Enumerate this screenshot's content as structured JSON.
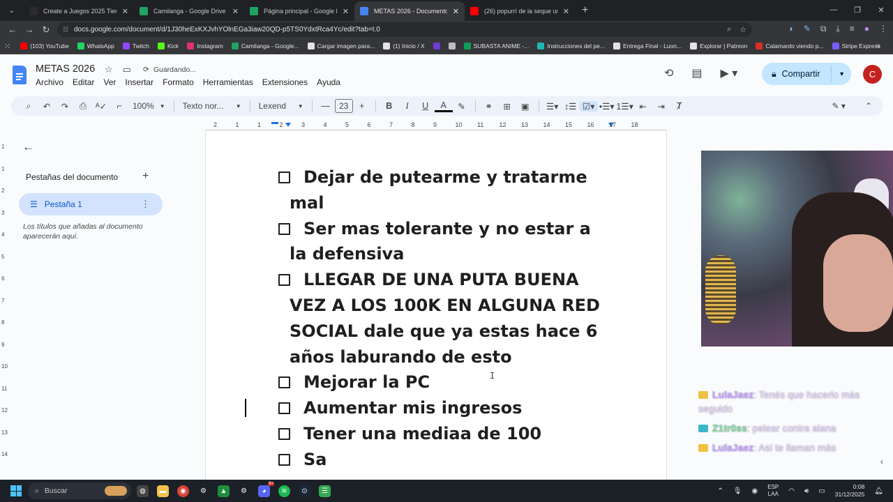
{
  "browser": {
    "tabs": [
      {
        "title": "Create a Juegos 2025 Tier List -",
        "color": "#2b2b2b",
        "active": false
      },
      {
        "title": "Camilanga - Google Drive",
        "color": "#1fa463",
        "active": false
      },
      {
        "title": "Página principal - Google Drive",
        "color": "#1fa463",
        "active": false
      },
      {
        "title": "METAS 2026 - Documentos de",
        "color": "#4285f4",
        "active": true
      },
      {
        "title": "(26) popurrí de ia seque un rio",
        "color": "#ff0000",
        "active": false
      }
    ],
    "url": "docs.google.com/document/d/1J30heExKXJvhYOlnEGa3iaw20QD-p5TS0YdxtRca4Yc/edit?tab=t.0",
    "bookmarks": [
      {
        "label": "(103) YouTube",
        "color": "#ff0000"
      },
      {
        "label": "WhatsApp",
        "color": "#25d366"
      },
      {
        "label": "Twitch",
        "color": "#9146ff"
      },
      {
        "label": "Kick",
        "color": "#53fc18"
      },
      {
        "label": "Instagram",
        "color": "#e1306c"
      },
      {
        "label": "Camilanga - Google...",
        "color": "#1fa463"
      },
      {
        "label": "Cargar imagen para...",
        "color": "#e3e3e3"
      },
      {
        "label": "(1) Inicio / X",
        "color": "#e3e3e3"
      },
      {
        "label": "",
        "color": "#6e3cd2"
      },
      {
        "label": "",
        "color": "#bdbdbd"
      },
      {
        "label": "SUBASTA ANIME -...",
        "color": "#0f9d58"
      },
      {
        "label": "Instrucciones del pe...",
        "color": "#1fb6b0"
      },
      {
        "label": "Entrega Final - Luon...",
        "color": "#e3e3e3"
      },
      {
        "label": "Explorar | Patreon",
        "color": "#e3e3e3"
      },
      {
        "label": "Calamardo viendo p...",
        "color": "#d93025"
      },
      {
        "label": "Stripe Express",
        "color": "#7a5cff"
      }
    ]
  },
  "docs": {
    "title": "METAS 2026",
    "saving": "Guardando...",
    "menu": [
      "Archivo",
      "Editar",
      "Ver",
      "Insertar",
      "Formato",
      "Herramientas",
      "Extensiones",
      "Ayuda"
    ],
    "share_label": "Compartir",
    "avatar_letter": "C",
    "toolbar": {
      "zoom": "100%",
      "style": "Texto nor...",
      "font": "Lexend",
      "font_size": "23"
    },
    "ruler": [
      "2",
      "1",
      "1",
      "2",
      "3",
      "4",
      "5",
      "6",
      "7",
      "8",
      "9",
      "10",
      "11",
      "12",
      "13",
      "14",
      "15",
      "16",
      "17",
      "18"
    ],
    "vruler": [
      "1",
      "1",
      "2",
      "3",
      "4",
      "5",
      "6",
      "7",
      "8",
      "9",
      "10",
      "11",
      "12",
      "13",
      "14"
    ],
    "sidebar": {
      "heading": "Pestañas del documento",
      "tab_label": "Pestaña 1",
      "note": "Los títulos que añadas al documento aparecerán aquí."
    },
    "checklist": [
      "Dejar de putearme y tratarme mal",
      "Ser mas tolerante y no estar a la defensiva",
      "LLEGAR DE UNA PUTA BUENA VEZ A LOS 100K EN ALGUNA RED SOCIAL dale que ya estas hace 6 años laburando de esto",
      "Mejorar la PC",
      "Aumentar mis ingresos",
      "Tener una mediaa de 100",
      "Sa"
    ]
  },
  "chat": [
    {
      "user": "LulaJaez",
      "message": ": Tenés que hacerlo más seguido",
      "badge": "crown"
    },
    {
      "user": "Z1tr0ss",
      "message": ": pelear contra alana",
      "badge": "twitch"
    },
    {
      "user": "LulaJaez",
      "message": ": Así te llaman más",
      "badge": "crown"
    }
  ],
  "taskbar": {
    "search_label": "Buscar",
    "lang_line1": "ESP",
    "lang_line2": "LAA",
    "time": "0:08",
    "date": "31/12/2025",
    "discord_badge": "9+"
  }
}
